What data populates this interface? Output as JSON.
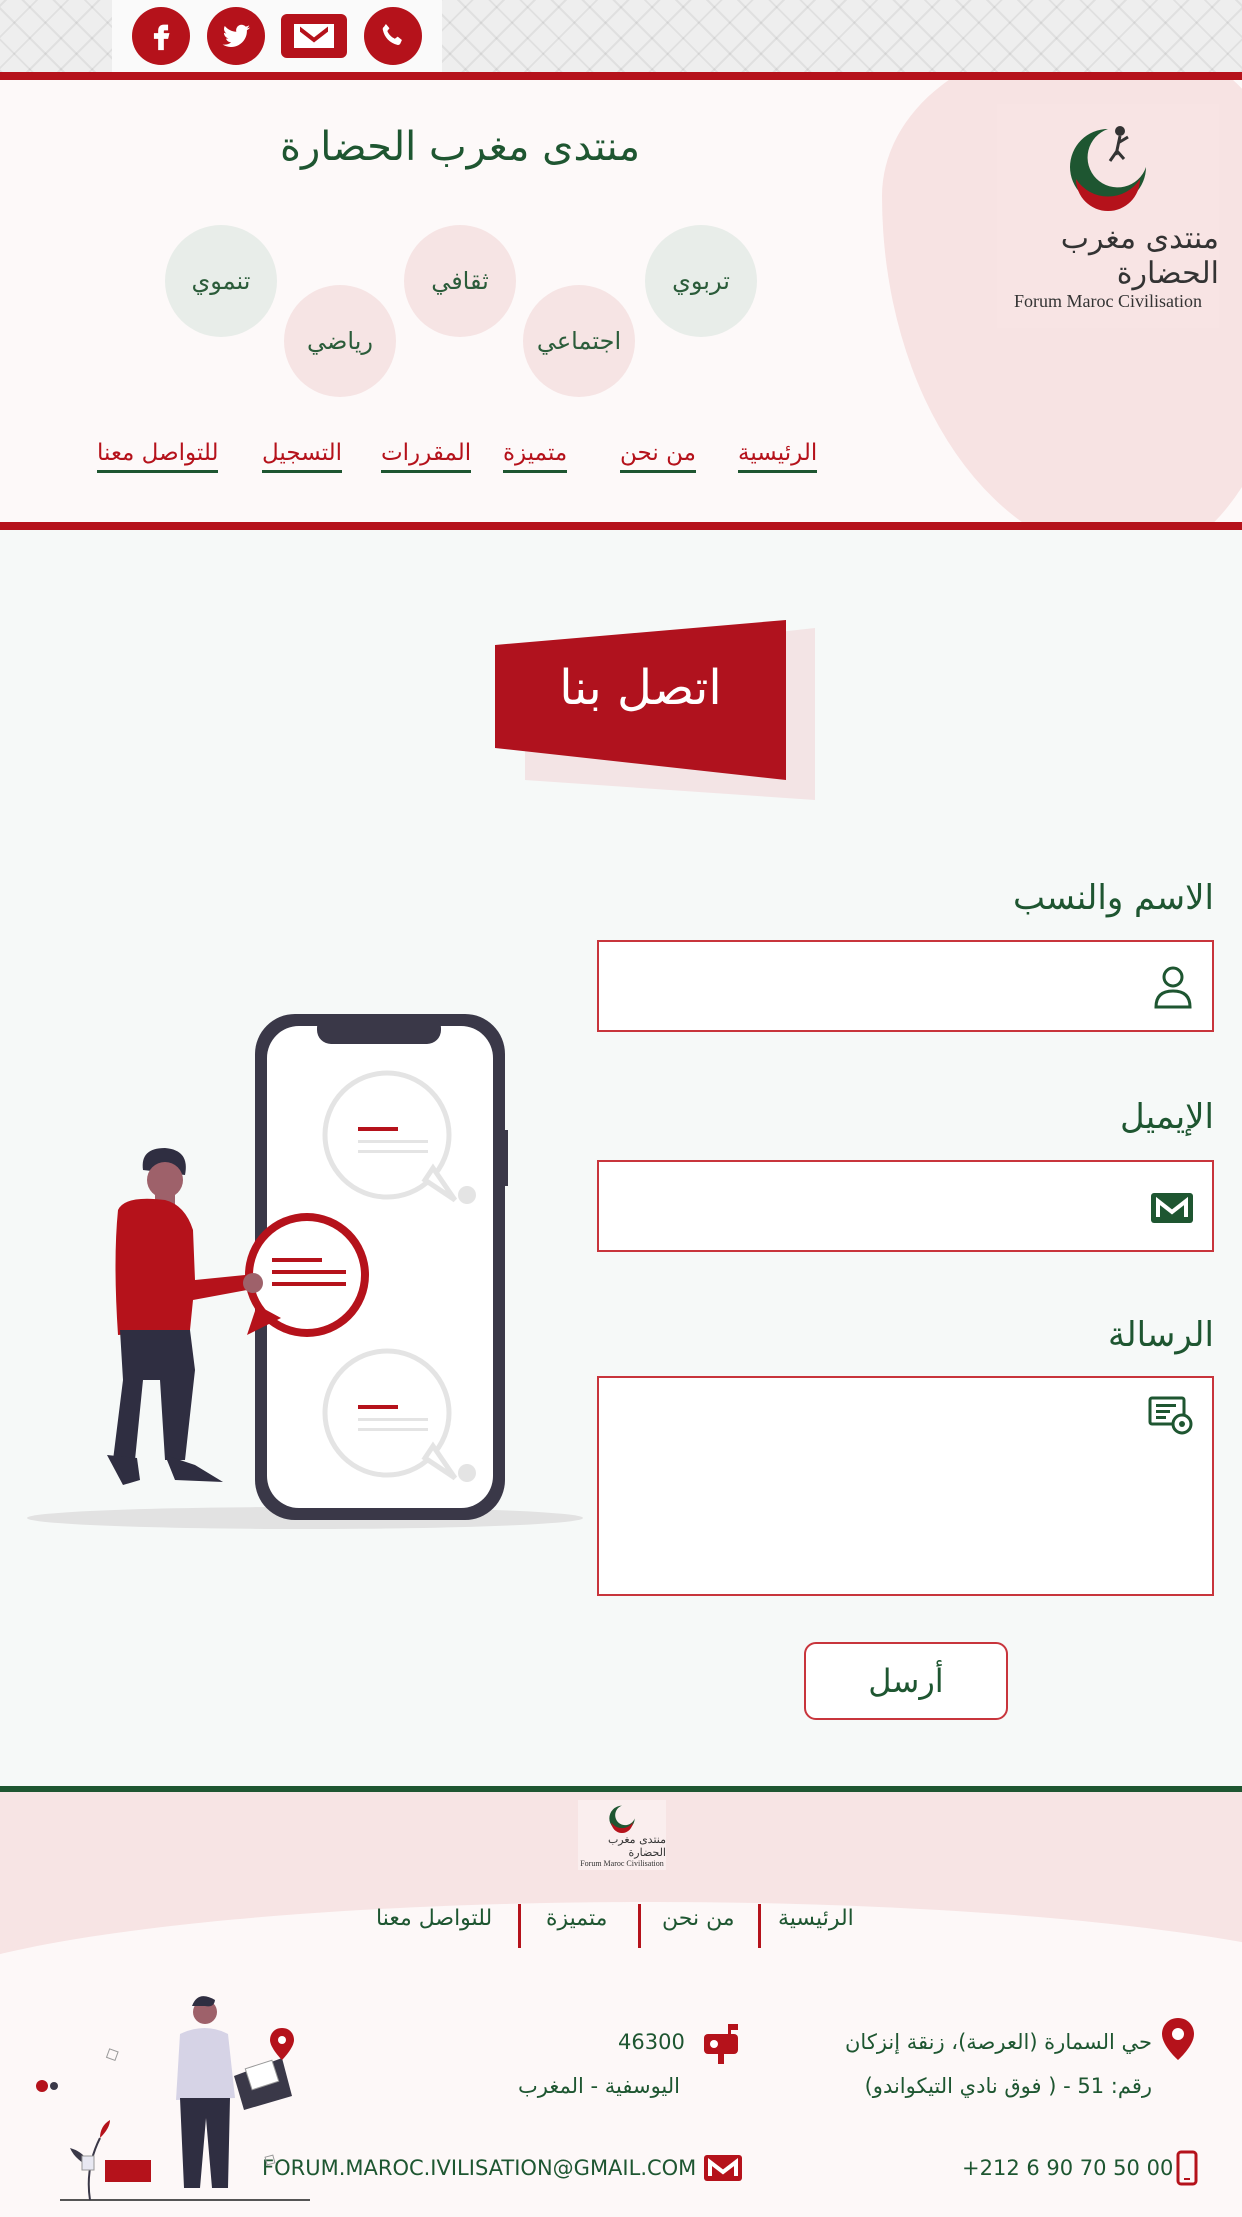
{
  "brand": {
    "site_title": "منتدى مغرب الحضارة",
    "logo_arabic": "منتدى مغرب الحضارة",
    "logo_latin": "Forum Maroc Civilisation",
    "colors": {
      "red": "#b5121b",
      "green": "#1e5631",
      "pink": "#f7e3e3"
    }
  },
  "social": [
    {
      "name": "facebook-icon"
    },
    {
      "name": "twitter-icon"
    },
    {
      "name": "gmail-icon"
    },
    {
      "name": "whatsapp-icon"
    }
  ],
  "categories": [
    "تربوي",
    "اجتماعي",
    "ثقافي",
    "رياضي",
    "تنموي"
  ],
  "nav": [
    "الرئيسية",
    "من نحن",
    "متميزة",
    "المقررات",
    "التسجيل",
    "للتواصل معنا"
  ],
  "contact": {
    "banner_title": "اتصل بنا",
    "name_label": "الاسم والنسب",
    "name_value": "",
    "email_label": "الإيميل",
    "email_value": "",
    "message_label": "الرسالة",
    "message_value": "",
    "send_label": "أرسل"
  },
  "footer": {
    "nav": [
      "الرئيسية",
      "من نحن",
      "متميزة",
      "للتواصل معنا"
    ],
    "address_line1": "حي السمارة (العرصة)، زنقة إنزكان",
    "address_line2": "رقم: 51 - ( فوق نادي التيكواندو)",
    "postal_code": "46300",
    "city": "اليوسفية - المغرب",
    "phone": "+212 6 90 70 50 00",
    "email": "FORUM.MAROC.IVILISATION@GMAIL.COM"
  }
}
